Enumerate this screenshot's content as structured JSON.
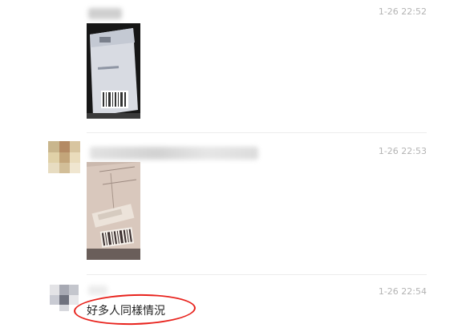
{
  "messages": [
    {
      "time": "1-26 22:52"
    },
    {
      "time": "1-26 22:53"
    },
    {
      "time": "1-26 22:54",
      "text": "好多人同樣情況"
    }
  ],
  "colors": {
    "highlight_circle": "#e8231d",
    "timestamp": "#b4b4b4",
    "divider": "#ececec"
  }
}
